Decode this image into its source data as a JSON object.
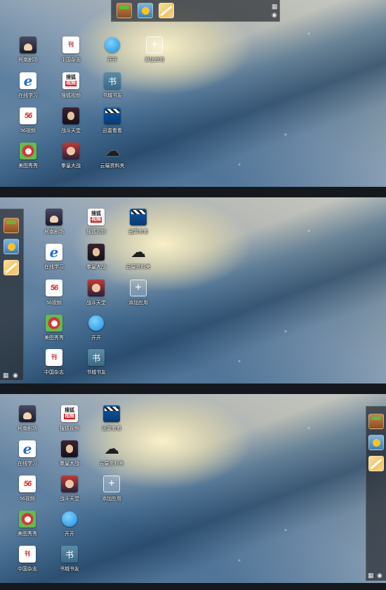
{
  "dock": {
    "apps": [
      {
        "name": "app-box",
        "icon": "gift-box-icon"
      },
      {
        "name": "weather",
        "icon": "sun-weather-icon"
      },
      {
        "name": "map",
        "icon": "map-icon"
      }
    ],
    "util_glyphs": {
      "grid": "▦",
      "settings": "◉"
    }
  },
  "screen1_icons": [
    {
      "label": "柯南剧场",
      "icon": "conan-icon"
    },
    {
      "label": "中国杂志",
      "icon": "magazine-icon"
    },
    {
      "label": "开开",
      "icon": "chat-bubble-icon"
    },
    {
      "label": "添加应用",
      "icon": "add-icon",
      "glyph": "+"
    },
    {
      "label": "在线学习",
      "icon": "ie-icon",
      "glyph": "e"
    },
    {
      "label": "搜狐视频",
      "icon": "sohu-video-icon",
      "line1": "搜狐",
      "line2": "视频"
    },
    {
      "label": "书城书友",
      "icon": "book-icon",
      "glyph": "书"
    },
    {
      "label": "56视频",
      "icon": "video56-icon",
      "glyph": "56"
    },
    {
      "label": "战斗天堂",
      "icon": "fighter-icon"
    },
    {
      "label": "迅雷看看",
      "icon": "clapper-icon"
    },
    {
      "label": "美图秀秀",
      "icon": "meitu-icon"
    },
    {
      "label": "拳皇大战",
      "icon": "fighter-icon"
    },
    {
      "label": "云端资料夹",
      "icon": "cloud-icon",
      "glyph": "☁"
    }
  ],
  "screen2_icons": [
    {
      "label": "柯南剧场",
      "icon": "conan-icon"
    },
    {
      "label": "搜狐视频",
      "icon": "sohu-video-icon",
      "line1": "搜狐",
      "line2": "视频"
    },
    {
      "label": "迅雷看看",
      "icon": "clapper-icon"
    },
    {
      "label": "在线学习",
      "icon": "ie-icon",
      "glyph": "e"
    },
    {
      "label": "拳皇大战",
      "icon": "guy-icon"
    },
    {
      "label": "云端资料夹",
      "icon": "cloud-icon",
      "glyph": "☁"
    },
    {
      "label": "56视频",
      "icon": "video56-icon",
      "glyph": "56"
    },
    {
      "label": "战斗天堂",
      "icon": "fighter-icon"
    },
    {
      "label": "添加应用",
      "icon": "add-icon",
      "glyph": "+"
    },
    {
      "label": "美图秀秀",
      "icon": "meitu-icon"
    },
    {
      "label": "开开",
      "icon": "chat-bubble-icon"
    },
    {
      "label": "中国杂志",
      "icon": "magazine-icon"
    },
    {
      "label": "书城书友",
      "icon": "book-icon",
      "glyph": "书"
    }
  ],
  "screen3_icons": [
    {
      "label": "柯南剧场",
      "icon": "conan-icon"
    },
    {
      "label": "搜狐视频",
      "icon": "sohu-video-icon",
      "line1": "搜狐",
      "line2": "视频"
    },
    {
      "label": "迅雷看看",
      "icon": "clapper-icon"
    },
    {
      "label": "在线学习",
      "icon": "ie-icon",
      "glyph": "e"
    },
    {
      "label": "拳皇大战",
      "icon": "guy-icon"
    },
    {
      "label": "云端资料夹",
      "icon": "cloud-icon",
      "glyph": "☁"
    },
    {
      "label": "56视频",
      "icon": "video56-icon",
      "glyph": "56"
    },
    {
      "label": "战斗天堂",
      "icon": "fighter-icon"
    },
    {
      "label": "添加应用",
      "icon": "add-icon",
      "glyph": "+"
    },
    {
      "label": "美图秀秀",
      "icon": "meitu-icon"
    },
    {
      "label": "开开",
      "icon": "chat-bubble-icon"
    },
    {
      "label": "中国杂志",
      "icon": "magazine-icon"
    },
    {
      "label": "书城书友",
      "icon": "book-icon",
      "glyph": "书"
    }
  ]
}
